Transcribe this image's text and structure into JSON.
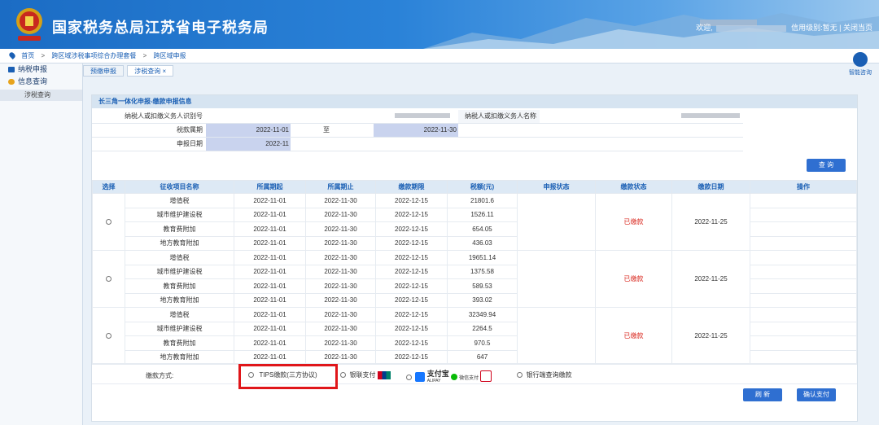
{
  "header": {
    "site_title": "国家税务总局江苏省电子税务局",
    "welcome": "欢迎,",
    "credit": "信用级别:暂无",
    "close": "关闭当页"
  },
  "breadcrumb": [
    "首页",
    "跨区域涉税事项综合办理套餐",
    "跨区域申报"
  ],
  "sidebar": {
    "items": [
      {
        "label": "纳税申报",
        "color": "#1a5fb4"
      },
      {
        "label": "信息查询",
        "color": "#e7a31c"
      }
    ],
    "sub": "涉税查询"
  },
  "help": "智能咨询",
  "tabs": [
    {
      "label": "预缴申报",
      "active": false
    },
    {
      "label": "涉税查询 ×",
      "active": true
    }
  ],
  "section_title": "长三角一体化申报-缴款申报信息",
  "form": {
    "taxpayer_id_label": "纳税人或扣缴义务人识别号",
    "taxpayer_name_label": "纳税人或扣缴义务人名称",
    "period_label": "税款属期",
    "period_from": "2022-11-01",
    "period_to_label": "至",
    "period_to": "2022-11-30",
    "apply_date_label": "申报日期",
    "apply_date": "2022-11"
  },
  "buttons": {
    "query": "查 询",
    "refresh": "刷 新",
    "confirm_pay": "确认支付"
  },
  "table": {
    "headers": [
      "选择",
      "征收项目名称",
      "所属期起",
      "所属期止",
      "缴款期限",
      "税额(元)",
      "申报状态",
      "缴款状态",
      "缴款日期",
      "操作"
    ],
    "groups": [
      {
        "status": "已缴款",
        "pay_date": "2022-11-25",
        "rows": [
          {
            "item": "增值税",
            "from": "2022-11-01",
            "to": "2022-11-30",
            "due": "2022-12-15",
            "amount": "21801.6"
          },
          {
            "item": "城市维护建设税",
            "from": "2022-11-01",
            "to": "2022-11-30",
            "due": "2022-12-15",
            "amount": "1526.11"
          },
          {
            "item": "教育费附加",
            "from": "2022-11-01",
            "to": "2022-11-30",
            "due": "2022-12-15",
            "amount": "654.05"
          },
          {
            "item": "地方教育附加",
            "from": "2022-11-01",
            "to": "2022-11-30",
            "due": "2022-12-15",
            "amount": "436.03"
          }
        ]
      },
      {
        "status": "已缴款",
        "pay_date": "2022-11-25",
        "rows": [
          {
            "item": "增值税",
            "from": "2022-11-01",
            "to": "2022-11-30",
            "due": "2022-12-15",
            "amount": "19651.14"
          },
          {
            "item": "城市维护建设税",
            "from": "2022-11-01",
            "to": "2022-11-30",
            "due": "2022-12-15",
            "amount": "1375.58"
          },
          {
            "item": "教育费附加",
            "from": "2022-11-01",
            "to": "2022-11-30",
            "due": "2022-12-15",
            "amount": "589.53"
          },
          {
            "item": "地方教育附加",
            "from": "2022-11-01",
            "to": "2022-11-30",
            "due": "2022-12-15",
            "amount": "393.02"
          }
        ]
      },
      {
        "status": "已缴款",
        "pay_date": "2022-11-25",
        "rows": [
          {
            "item": "增值税",
            "from": "2022-11-01",
            "to": "2022-11-30",
            "due": "2022-12-15",
            "amount": "32349.94"
          },
          {
            "item": "城市维护建设税",
            "from": "2022-11-01",
            "to": "2022-11-30",
            "due": "2022-12-15",
            "amount": "2264.5"
          },
          {
            "item": "教育费附加",
            "from": "2022-11-01",
            "to": "2022-11-30",
            "due": "2022-12-15",
            "amount": "970.5"
          },
          {
            "item": "地方教育附加",
            "from": "2022-11-01",
            "to": "2022-11-30",
            "due": "2022-12-15",
            "amount": "647"
          }
        ]
      }
    ]
  },
  "payment": {
    "label": "缴款方式:",
    "tips": "TIPS缴款(三方协议)",
    "unionpay": "银联支付",
    "alipay": "支付宝",
    "alipay_en": "ALIPAY",
    "wechat": "微信支付",
    "bank": "银行端查询缴款"
  }
}
